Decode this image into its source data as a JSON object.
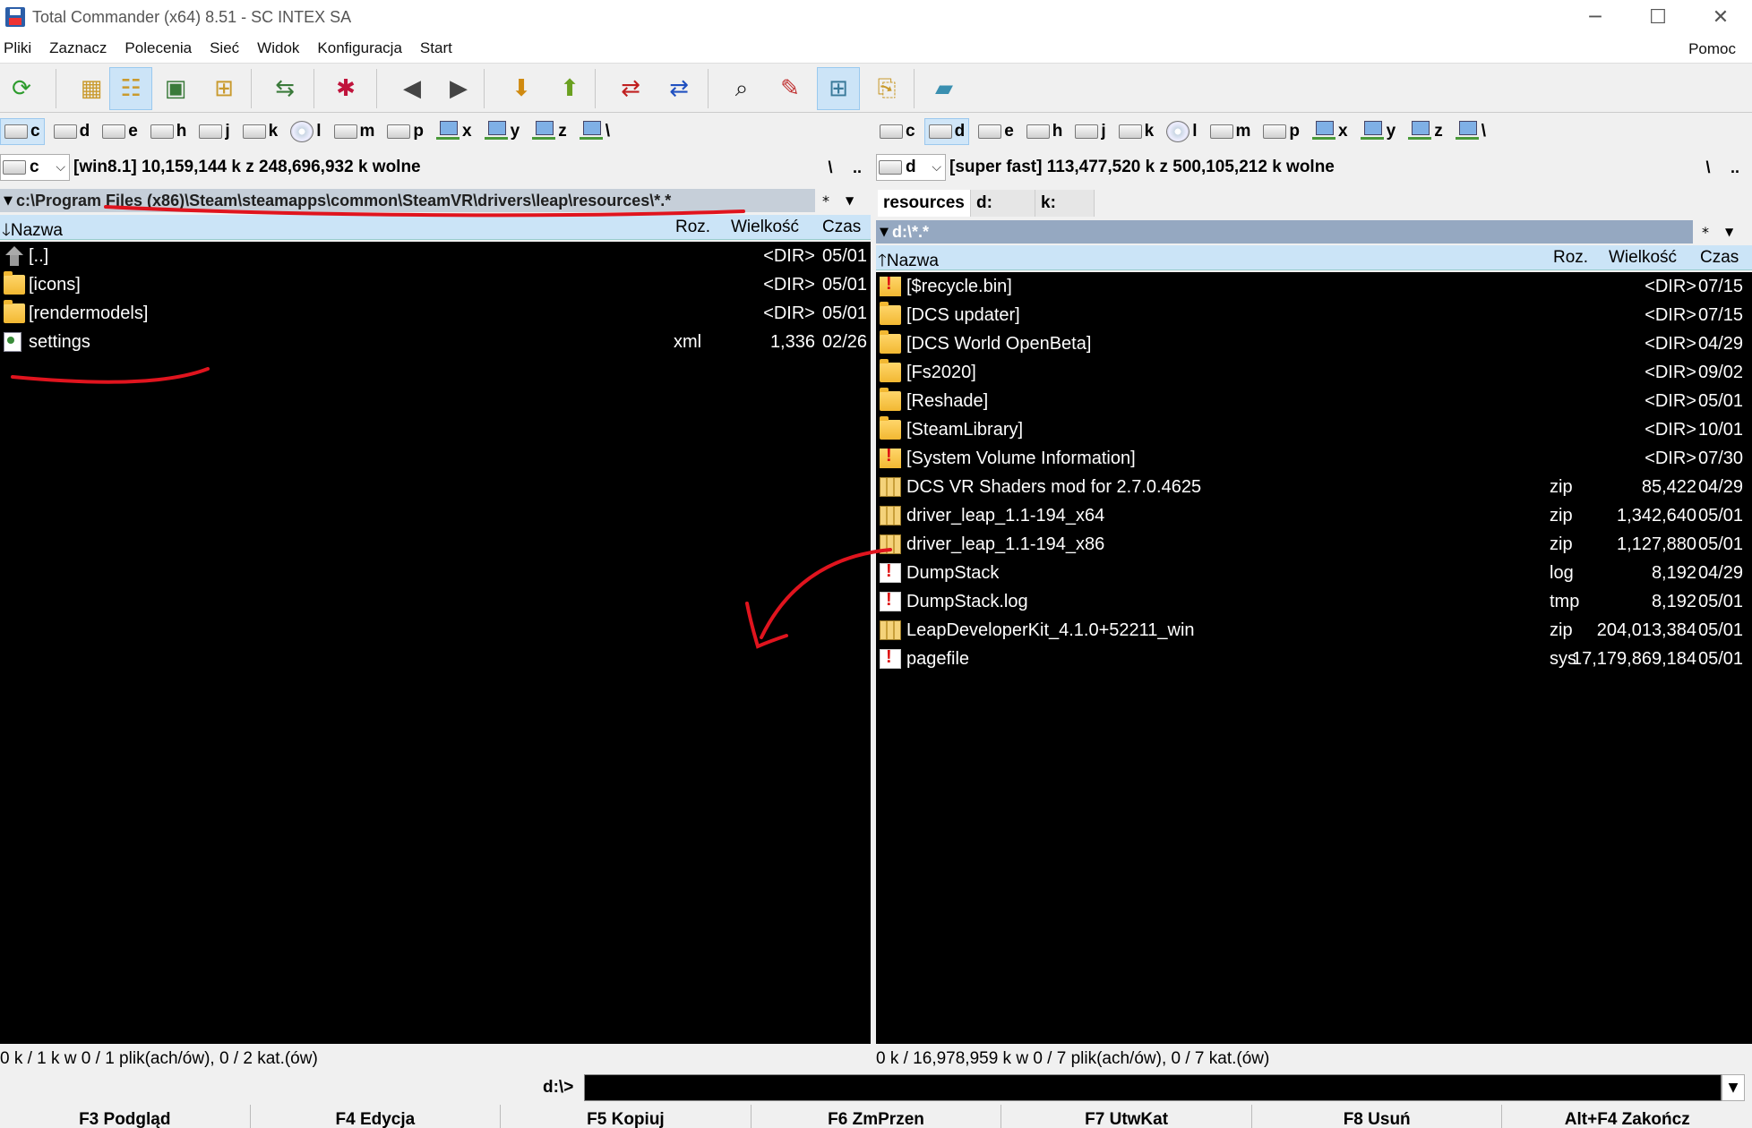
{
  "window": {
    "title": "Total Commander (x64) 8.51 - SC INTEX SA",
    "controls": {
      "minimize": "─",
      "maximize": "☐",
      "close": "✕"
    }
  },
  "menu": {
    "items": [
      "Pliki",
      "Zaznacz",
      "Polecenia",
      "Sieć",
      "Widok",
      "Konfiguracja",
      "Start"
    ],
    "help": "Pomoc"
  },
  "toolbar": {
    "icons": [
      {
        "name": "refresh-icon",
        "glyph": "⟳",
        "color": "#2e9c2e"
      },
      {
        "name": "brief-view-icon",
        "glyph": "▦",
        "color": "#c99a2e"
      },
      {
        "name": "full-view-icon",
        "glyph": "☷",
        "color": "#c99a2e"
      },
      {
        "name": "thumbnails-icon",
        "glyph": "▣",
        "color": "#3a7a3a"
      },
      {
        "name": "tree-view-icon",
        "glyph": "⊞",
        "color": "#c99a2e"
      },
      {
        "name": "compare-dirs-icon",
        "glyph": "⇆",
        "color": "#3a7a3a"
      },
      {
        "name": "select-icon",
        "glyph": "✱",
        "color": "#c0143c"
      },
      {
        "name": "back-icon",
        "glyph": "◀",
        "color": "#444"
      },
      {
        "name": "forward-icon",
        "glyph": "▶",
        "color": "#444"
      },
      {
        "name": "pack-icon",
        "glyph": "⬇",
        "color": "#d08a10"
      },
      {
        "name": "unpack-icon",
        "glyph": "⬆",
        "color": "#6aa020"
      },
      {
        "name": "ftp-icon",
        "glyph": "⇄",
        "color": "#c02020"
      },
      {
        "name": "url-icon",
        "glyph": "⇄",
        "color": "#2050c0"
      },
      {
        "name": "search-icon",
        "glyph": "⌕",
        "color": "#222"
      },
      {
        "name": "multi-rename-icon",
        "glyph": "✎",
        "color": "#c03030"
      },
      {
        "name": "sync-dirs-icon",
        "glyph": "⊞",
        "color": "#3a7a9a"
      },
      {
        "name": "copy-names-icon",
        "glyph": "⎘",
        "color": "#c99a2e"
      },
      {
        "name": "notepad-icon",
        "glyph": "▰",
        "color": "#3a8fb0"
      }
    ]
  },
  "left": {
    "drives": [
      {
        "letter": "c",
        "type": "hdd",
        "active": true
      },
      {
        "letter": "d",
        "type": "hdd"
      },
      {
        "letter": "e",
        "type": "hdd"
      },
      {
        "letter": "h",
        "type": "hdd"
      },
      {
        "letter": "j",
        "type": "hdd"
      },
      {
        "letter": "k",
        "type": "hdd"
      },
      {
        "letter": "l",
        "type": "cd"
      },
      {
        "letter": "m",
        "type": "hdd"
      },
      {
        "letter": "p",
        "type": "hdd"
      },
      {
        "letter": "x",
        "type": "net"
      },
      {
        "letter": "y",
        "type": "net"
      },
      {
        "letter": "z",
        "type": "net"
      },
      {
        "letter": "\\",
        "type": "net"
      }
    ],
    "combo_drive": "c",
    "info": "[win8.1]  10,159,144 k z 248,696,932 k wolne",
    "root_btn": "\\",
    "up_btn": "..",
    "path": "c:\\Program Files (x86)\\Steam\\steamapps\\common\\SteamVR\\drivers\\leap\\resources\\*.*",
    "filter": "*",
    "filter_arrow": "▼",
    "columns": {
      "name": "Nazwa",
      "ext": "Roz.",
      "size": "Wielkość",
      "date": "Czas"
    },
    "sort_arrow": "🡓",
    "files": [
      {
        "icon": "up",
        "name": "[..]",
        "ext": "",
        "size": "<DIR>",
        "date": "05/01"
      },
      {
        "icon": "folder",
        "name": "[icons]",
        "ext": "",
        "size": "<DIR>",
        "date": "05/01"
      },
      {
        "icon": "folder",
        "name": "[rendermodels]",
        "ext": "",
        "size": "<DIR>",
        "date": "05/01"
      },
      {
        "icon": "doc",
        "name": "settings",
        "ext": "xml",
        "size": "1,336",
        "date": "02/26"
      }
    ],
    "status": "0 k / 1 k w 0 / 1 plik(ach/ów), 0 / 2 kat.(ów)"
  },
  "right": {
    "drives": [
      {
        "letter": "c",
        "type": "hdd"
      },
      {
        "letter": "d",
        "type": "hdd",
        "active": true
      },
      {
        "letter": "e",
        "type": "hdd"
      },
      {
        "letter": "h",
        "type": "hdd"
      },
      {
        "letter": "j",
        "type": "hdd"
      },
      {
        "letter": "k",
        "type": "hdd"
      },
      {
        "letter": "l",
        "type": "cd"
      },
      {
        "letter": "m",
        "type": "hdd"
      },
      {
        "letter": "p",
        "type": "hdd"
      },
      {
        "letter": "x",
        "type": "net"
      },
      {
        "letter": "y",
        "type": "net"
      },
      {
        "letter": "z",
        "type": "net"
      },
      {
        "letter": "\\",
        "type": "net"
      }
    ],
    "combo_drive": "d",
    "info": "[super fast]  113,477,520 k z 500,105,212 k wolne",
    "root_btn": "\\",
    "up_btn": "..",
    "tabs": [
      "resources",
      "d:",
      "k:"
    ],
    "path": "d:\\*.*",
    "filter": "*",
    "filter_arrow": "▼",
    "columns": {
      "name": "Nazwa",
      "ext": "Roz.",
      "size": "Wielkość",
      "date": "Czas"
    },
    "sort_arrow": "🡑",
    "files": [
      {
        "icon": "sysfolder",
        "name": "[$recycle.bin]",
        "ext": "",
        "size": "<DIR>",
        "date": "07/15"
      },
      {
        "icon": "folder",
        "name": "[DCS updater]",
        "ext": "",
        "size": "<DIR>",
        "date": "07/15"
      },
      {
        "icon": "folder",
        "name": "[DCS World OpenBeta]",
        "ext": "",
        "size": "<DIR>",
        "date": "04/29"
      },
      {
        "icon": "folder",
        "name": "[Fs2020]",
        "ext": "",
        "size": "<DIR>",
        "date": "09/02"
      },
      {
        "icon": "folder",
        "name": "[Reshade]",
        "ext": "",
        "size": "<DIR>",
        "date": "05/01"
      },
      {
        "icon": "folder",
        "name": "[SteamLibrary]",
        "ext": "",
        "size": "<DIR>",
        "date": "10/01"
      },
      {
        "icon": "sysfolder",
        "name": "[System Volume Information]",
        "ext": "",
        "size": "<DIR>",
        "date": "07/30"
      },
      {
        "icon": "zip",
        "name": "DCS VR Shaders mod for 2.7.0.4625",
        "ext": "zip",
        "size": "85,422",
        "date": "04/29"
      },
      {
        "icon": "zip",
        "name": "driver_leap_1.1-194_x64",
        "ext": "zip",
        "size": "1,342,640",
        "date": "05/01"
      },
      {
        "icon": "zip",
        "name": "driver_leap_1.1-194_x86",
        "ext": "zip",
        "size": "1,127,880",
        "date": "05/01"
      },
      {
        "icon": "sys",
        "name": "DumpStack",
        "ext": "log",
        "size": "8,192",
        "date": "04/29"
      },
      {
        "icon": "sys",
        "name": "DumpStack.log",
        "ext": "tmp",
        "size": "8,192",
        "date": "05/01"
      },
      {
        "icon": "zip",
        "name": "LeapDeveloperKit_4.1.0+52211_win",
        "ext": "zip",
        "size": "204,013,384",
        "date": "05/01"
      },
      {
        "icon": "sys",
        "name": "pagefile",
        "ext": "sys",
        "size": "17,179,869,184",
        "date": "05/01"
      }
    ],
    "status": "0 k / 16,978,959 k w 0 / 7 plik(ach/ów), 0 / 7 kat.(ów)"
  },
  "cmdline": {
    "prompt": "d:\\>",
    "value": "",
    "arrow": "▼"
  },
  "fkeys": [
    "F3 Podgląd",
    "F4 Edycja",
    "F5 Kopiuj",
    "F6 ZmPrzen",
    "F7 UtwKat",
    "F8 Usuń",
    "Alt+F4 Zakończ"
  ],
  "colors": {
    "panel_bg": "#000000",
    "panel_text": "#ffffff",
    "header_bg": "#cbe4f7",
    "path_active_bg": "#c6cfd9",
    "path_inactive_bg": "#95a8c1",
    "annotation": "#e0141e"
  }
}
